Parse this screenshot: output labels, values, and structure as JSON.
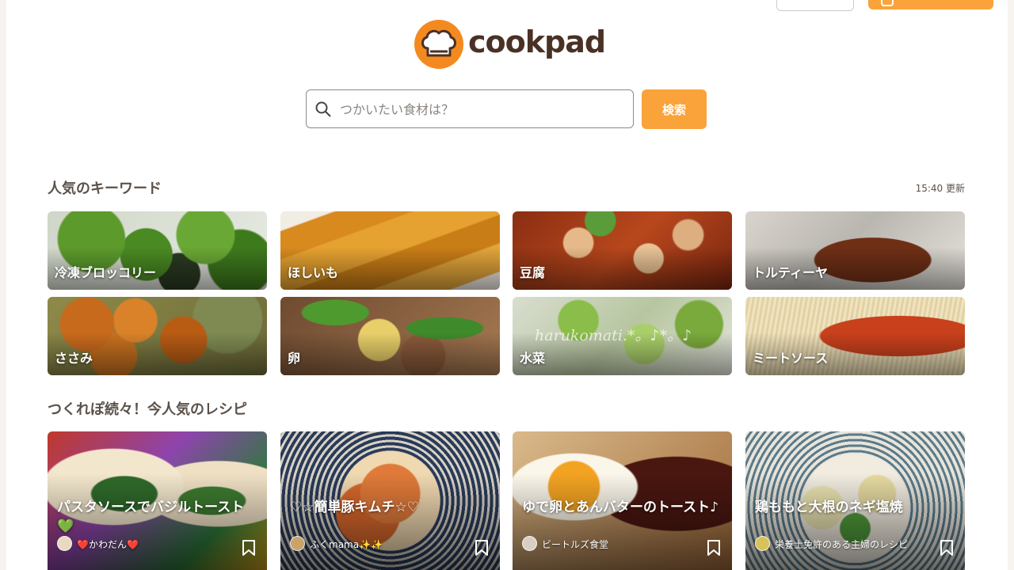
{
  "brand": {
    "name": "cookpad",
    "accent": "#f9a33a",
    "logo_color": "#f48a1f"
  },
  "search": {
    "placeholder": "つかいたい食材は？",
    "button_label": "検索",
    "icon": "search-icon"
  },
  "keywords_section": {
    "title": "人気のキーワード",
    "updated": "15:40 更新",
    "items": [
      {
        "label": "冷凍ブロッコリー"
      },
      {
        "label": "ほしいも"
      },
      {
        "label": "豆腐"
      },
      {
        "label": "トルティーヤ"
      },
      {
        "label": "ささみ"
      },
      {
        "label": "卵"
      },
      {
        "label": "水菜",
        "watermark": "harukomati.*。♪*。♪"
      },
      {
        "label": "ミートソース"
      }
    ]
  },
  "recipes_section": {
    "title": "つくれぽ続々！今人気のレシピ",
    "items": [
      {
        "title": "パスタソースでバジルトースト💚",
        "author": "❤️かわだん❤️"
      },
      {
        "title": "♡☆簡単豚キムチ☆♡",
        "author": "ふくmama✨✨"
      },
      {
        "title": "ゆで卵とあんバターのトースト♪",
        "author": "ビートルズ食堂"
      },
      {
        "title": "鶏ももと大根のネギ塩焼",
        "author": "栄養士免許のある主婦のレシピ"
      }
    ]
  }
}
